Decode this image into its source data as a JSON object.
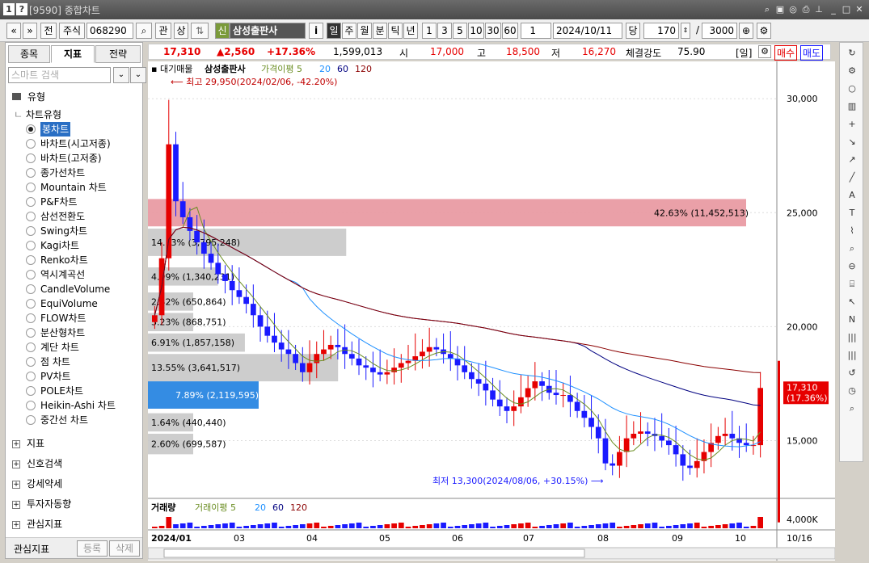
{
  "window": {
    "title_code": "[9590]",
    "title": "종합차트",
    "icon_left": "1",
    "icon_right": "?"
  },
  "toolbar": {
    "nav_prev": "«",
    "nav_next": "»",
    "btn_prev": "전",
    "btn_stock": "주식",
    "code": "068290",
    "search_icon": "search-icon",
    "btn_gwan": "관",
    "btn_sang": "상",
    "badge": "신",
    "stock_name": "삼성출판사",
    "info_btn": "i",
    "periods": [
      "일",
      "주",
      "월",
      "분",
      "틱",
      "년"
    ],
    "intervals": [
      "1",
      "3",
      "5",
      "10",
      "30",
      "60"
    ],
    "interval_value": "1",
    "date": "2024/10/11",
    "dang": "당",
    "count": "170",
    "slash": "/",
    "max": "3000"
  },
  "sidebar": {
    "tabs": [
      "종목",
      "지표",
      "전략"
    ],
    "search_placeholder": "스마트 검색",
    "root": "유형",
    "group": "차트유형",
    "chart_types": [
      "봉차트",
      "바차트(시고저종)",
      "바차트(고저종)",
      "종가선차트",
      "Mountain 차트",
      "P&F차트",
      "삼선전환도",
      "Swing차트",
      "Kagi차트",
      "Renko차트",
      "역시계곡선",
      "CandleVolume",
      "EquiVolume",
      "FLOW차트",
      "분산형차트",
      "계단 차트",
      "점 차트",
      "PV차트",
      "POLE차트",
      "Heikin-Ashi 차트",
      "중간선 차트"
    ],
    "groups": [
      "지표",
      "신호검색",
      "강세약세",
      "투자자동향",
      "관심지표"
    ],
    "footer_label": "관심지표",
    "footer_add": "등록",
    "footer_del": "삭제"
  },
  "infobar": {
    "price": "17,310",
    "change": "▲2,560",
    "pct": "+17.36%",
    "volume": "1,599,013",
    "open_label": "시",
    "open": "17,000",
    "high_label": "고",
    "high": "18,500",
    "low_label": "저",
    "low": "16,270",
    "strength_label": "체결강도",
    "strength": "75.90",
    "period_tag": "[일]",
    "buy": "매수",
    "sell": "매도"
  },
  "chart_data": {
    "type": "candlestick",
    "legend": {
      "vol_profile": "대기매물",
      "name": "삼성출판사",
      "ma_label": "가격이평",
      "ma": [
        "5",
        "20",
        "60",
        "120"
      ]
    },
    "yaxis_ticks": [
      "30,000",
      "25,000",
      "20,000",
      "15,000"
    ],
    "ylim": [
      12500,
      31000
    ],
    "x_ticks": [
      "2024/01",
      "03",
      "04",
      "05",
      "06",
      "07",
      "08",
      "09",
      "10"
    ],
    "high_note": "최고 29,950(2024/02/06, -42.20%)",
    "low_note": "최저 13,300(2024/08/06, +30.15%)",
    "price_tag": "17,310",
    "price_tag_pct": "(17.36%)",
    "volume_profile": [
      {
        "label": "42.63% (11,452,513)",
        "pct": 42.63
      },
      {
        "label": "14.13% (3,795,248)",
        "pct": 14.13
      },
      {
        "label": "4.99% (1,340,231)",
        "pct": 4.99
      },
      {
        "label": "2.42% (650,864)",
        "pct": 2.42
      },
      {
        "label": "3.23% (868,751)",
        "pct": 3.23
      },
      {
        "label": "6.91% (1,857,158)",
        "pct": 6.91
      },
      {
        "label": "13.55% (3,641,517)",
        "pct": 13.55
      },
      {
        "label": "7.89% (2,119,595)",
        "pct": 7.89
      },
      {
        "label": "1.64% (440,440)",
        "pct": 1.64
      },
      {
        "label": "2.60% (699,587)",
        "pct": 2.6
      }
    ],
    "volume_panel": {
      "title": "거래량",
      "ma_label": "거래이평",
      "ma": [
        "5",
        "20",
        "60",
        "120"
      ],
      "tick": "4,000K",
      "last_date": "10/16"
    },
    "series_closes": [
      20500,
      23000,
      28000,
      25500,
      24800,
      24200,
      23700,
      23200,
      22800,
      22300,
      22000,
      21600,
      21300,
      21000,
      20500,
      20000,
      19600,
      19300,
      19000,
      18800,
      18400,
      18000,
      18400,
      18800,
      19000,
      19200,
      19100,
      18800,
      18600,
      18300,
      18200,
      18000,
      17900,
      18000,
      18200,
      18400,
      18500,
      18700,
      18900,
      19100,
      19000,
      18800,
      18600,
      18300,
      18000,
      17700,
      17500,
      17200,
      16800,
      16500,
      16300,
      16500,
      16900,
      17300,
      17600,
      17400,
      17100,
      17000,
      17000,
      16700,
      16300,
      16000,
      15600,
      15100,
      14000,
      13900,
      14500,
      15100,
      15300,
      15400,
      15300,
      15200,
      15000,
      14800,
      14400,
      13900,
      13800,
      14100,
      14500,
      14900,
      15200,
      15300,
      15100,
      14900,
      14800,
      14800,
      17310
    ]
  },
  "colors": {
    "up": "#e60000",
    "down": "#1a1aff",
    "ma5": "#6b8e23",
    "ma20": "#1e90ff",
    "ma60": "#000080",
    "ma120": "#8b0000"
  }
}
